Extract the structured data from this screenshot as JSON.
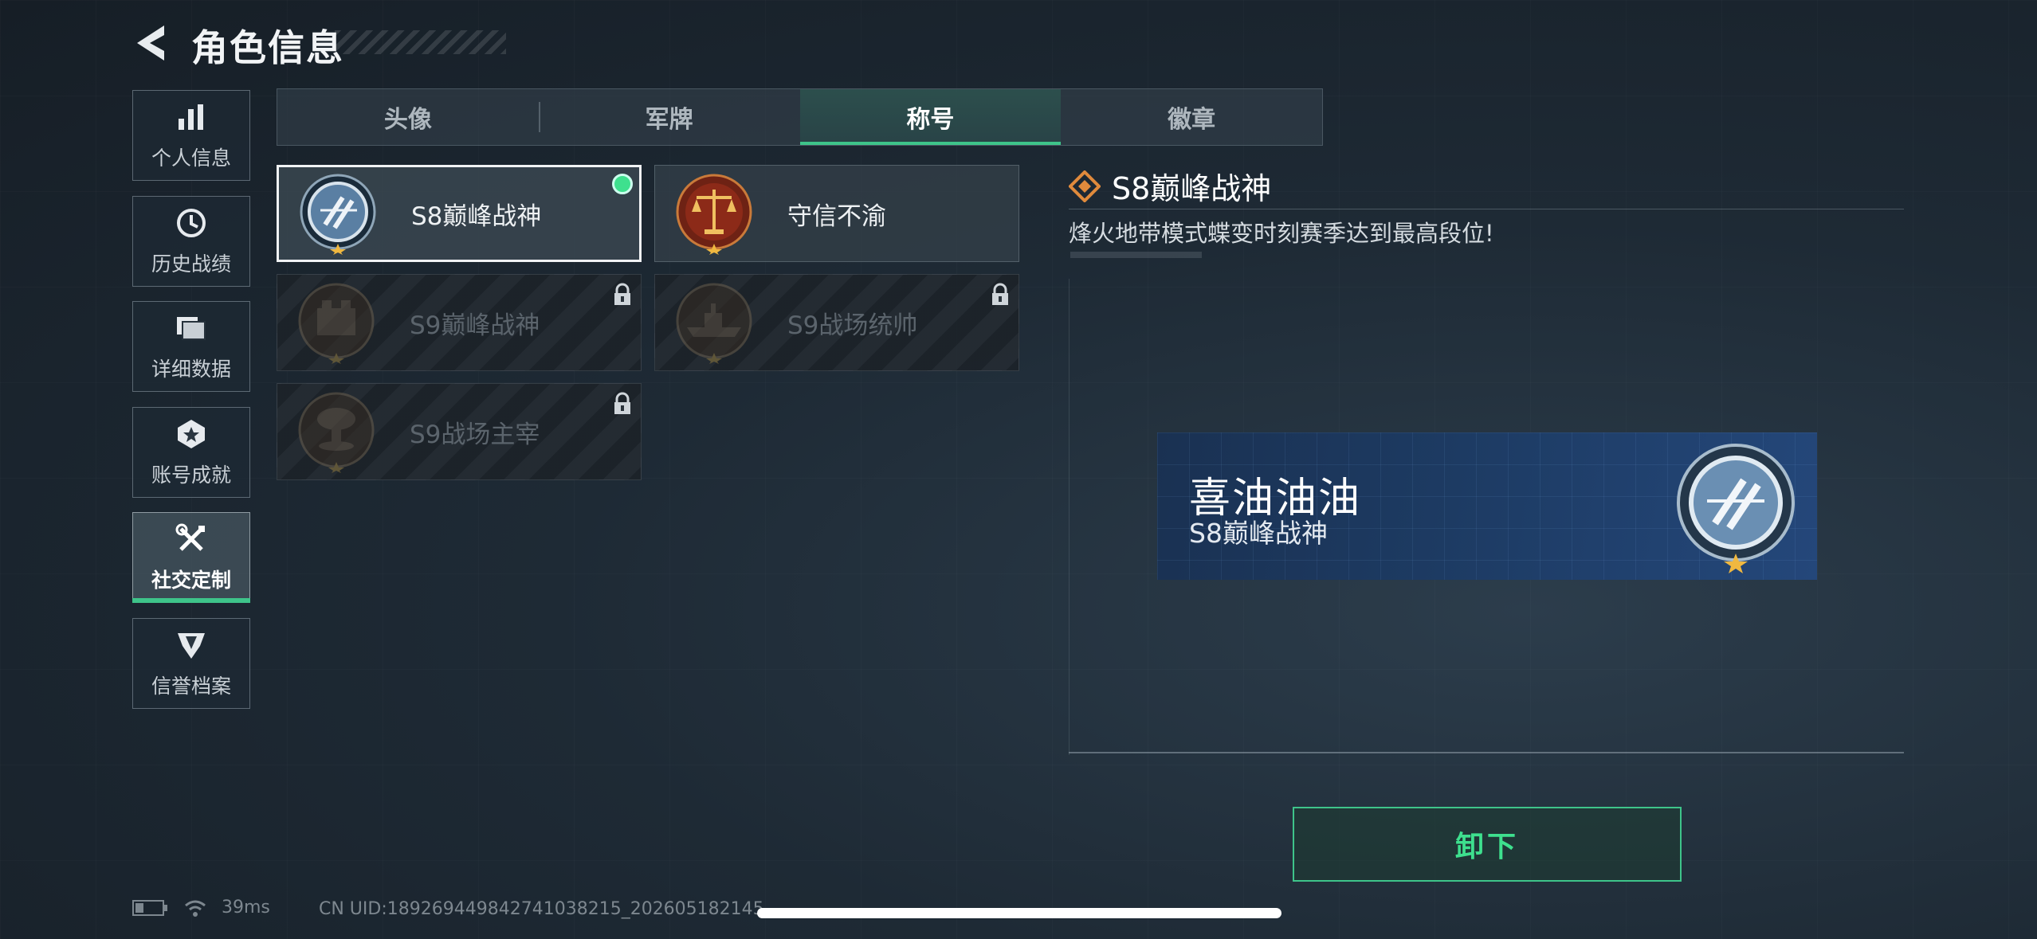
{
  "header": {
    "title": "角色信息"
  },
  "sidebar": {
    "items": [
      {
        "label": "个人信息",
        "icon": "bar-chart-icon"
      },
      {
        "label": "历史战绩",
        "icon": "history-clock-icon"
      },
      {
        "label": "详细数据",
        "icon": "folder-icon"
      },
      {
        "label": "账号成就",
        "icon": "medal-icon"
      },
      {
        "label": "社交定制",
        "icon": "tools-icon",
        "active": true
      },
      {
        "label": "信誉档案",
        "icon": "shield-badge-icon"
      }
    ]
  },
  "tabs": [
    {
      "label": "头像"
    },
    {
      "label": "军牌"
    },
    {
      "label": "称号",
      "active": true
    },
    {
      "label": "徽章"
    }
  ],
  "titles": [
    {
      "name": "S8巅峰战神",
      "equipped": true,
      "locked": false,
      "emblem": "blue-laurel-emblem"
    },
    {
      "name": "守信不渝",
      "equipped": false,
      "locked": false,
      "emblem": "scales-of-justice-emblem"
    },
    {
      "name": "S9巅峰战神",
      "equipped": false,
      "locked": true,
      "emblem": "fortress-emblem"
    },
    {
      "name": "S9战场统帅",
      "equipped": false,
      "locked": true,
      "emblem": "warship-emblem"
    },
    {
      "name": "S9战场主宰",
      "equipped": false,
      "locked": true,
      "emblem": "mushroom-cloud-emblem"
    }
  ],
  "detail": {
    "title": "S8巅峰战神",
    "description": "烽火地带模式蝶变时刻赛季达到最高段位!"
  },
  "nameplate": {
    "player_name": "喜油油油",
    "title": "S8巅峰战神"
  },
  "actions": {
    "unequip_label": "卸下"
  },
  "status": {
    "ping": "39ms",
    "uid": "CN UID:189269449842741038215_202605182145"
  },
  "colors": {
    "accent": "#3ec48a",
    "equipped_dot": "#3ee08e",
    "nameplate_bg": "#1d3b63"
  }
}
